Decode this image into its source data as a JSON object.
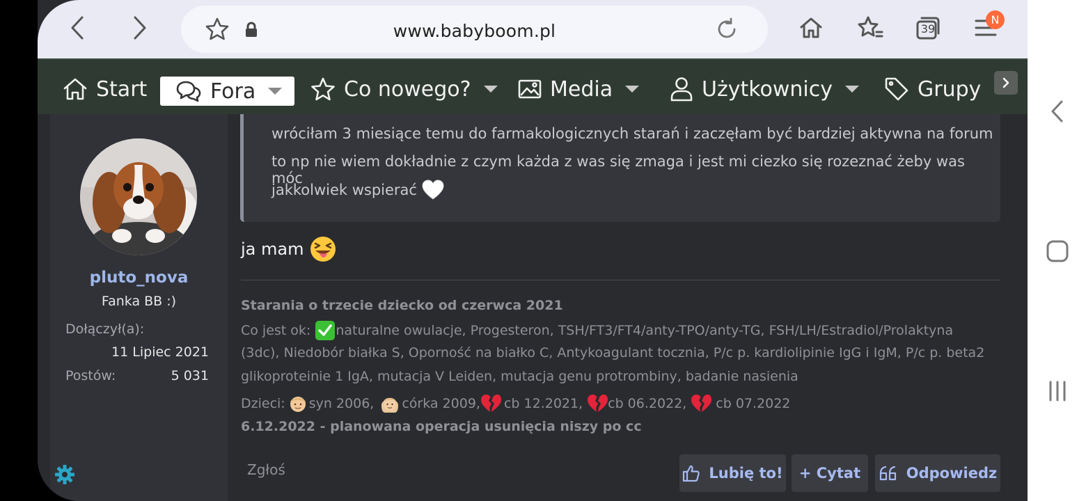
{
  "browser": {
    "url": "www.babyboom.pl",
    "tabs_count": "39",
    "menu_badge": "N"
  },
  "nav": {
    "start": "Start",
    "fora": "Fora",
    "co_nowego": "Co nowego?",
    "media": "Media",
    "uzytkownicy": "Użytkownicy",
    "grupy": "Grupy"
  },
  "user": {
    "name": "pluto_nova",
    "title": "Fanka BB :)",
    "joined_label": "Dołączył(a):",
    "joined_value": "11 Lipiec 2021",
    "posts_label": "Postów:",
    "posts_value": "5 031"
  },
  "quote": {
    "line1": "wróciłam 3 miesiące temu do farmakologicznych starań i zaczęłam być bardziej aktywna na forum",
    "line2": "to np nie wiem dokładnie z czym każda z was się zmaga i jest mi ciezko się rozeznać żeby was móc",
    "line3": "jakkolwiek wspierać",
    "emoji": "white-heart"
  },
  "post": {
    "text": "ja mam",
    "emoji": "squinting-face-with-tongue"
  },
  "signature": {
    "title": "Starania o trzecie dziecko od czerwca 2021",
    "ok_prefix": "Co jest ok:",
    "ok_line1": "naturalne owulacje, Progesteron, TSH/FT3/FT4/anty-TPO/anty-TG, FSH/LH/Estradiol/Prolaktyna",
    "ok_line2": "(3dc), Niedobór białka S, Oporność na białko C, Antykoagulant tocznia, P/c p. kardiolipinie IgG i IgM, P/c p. beta2",
    "ok_line3": "glikoproteinie 1 IgA, mutacja V Leiden, mutacja genu protrombiny, badanie nasienia",
    "kids_prefix": "Dzieci:",
    "kid1": "syn 2006,",
    "kid2": "córka 2009,",
    "loss1": "cb 12.2021,",
    "loss2": "cb 06.2022,",
    "loss3": "cb 07.2022",
    "operation": "6.12.2022 - planowana operacja usunięcia niszy po cc"
  },
  "actions": {
    "report": "Zgłoś",
    "like": "Lubię to!",
    "quote": "+ Cytat",
    "reply": "Odpowiedz"
  },
  "colors": {
    "nav_bg": "#2f3b32",
    "page_bg": "#2a2b2f",
    "link": "#9fb6e8",
    "accent_badge": "#ff6a3d"
  }
}
